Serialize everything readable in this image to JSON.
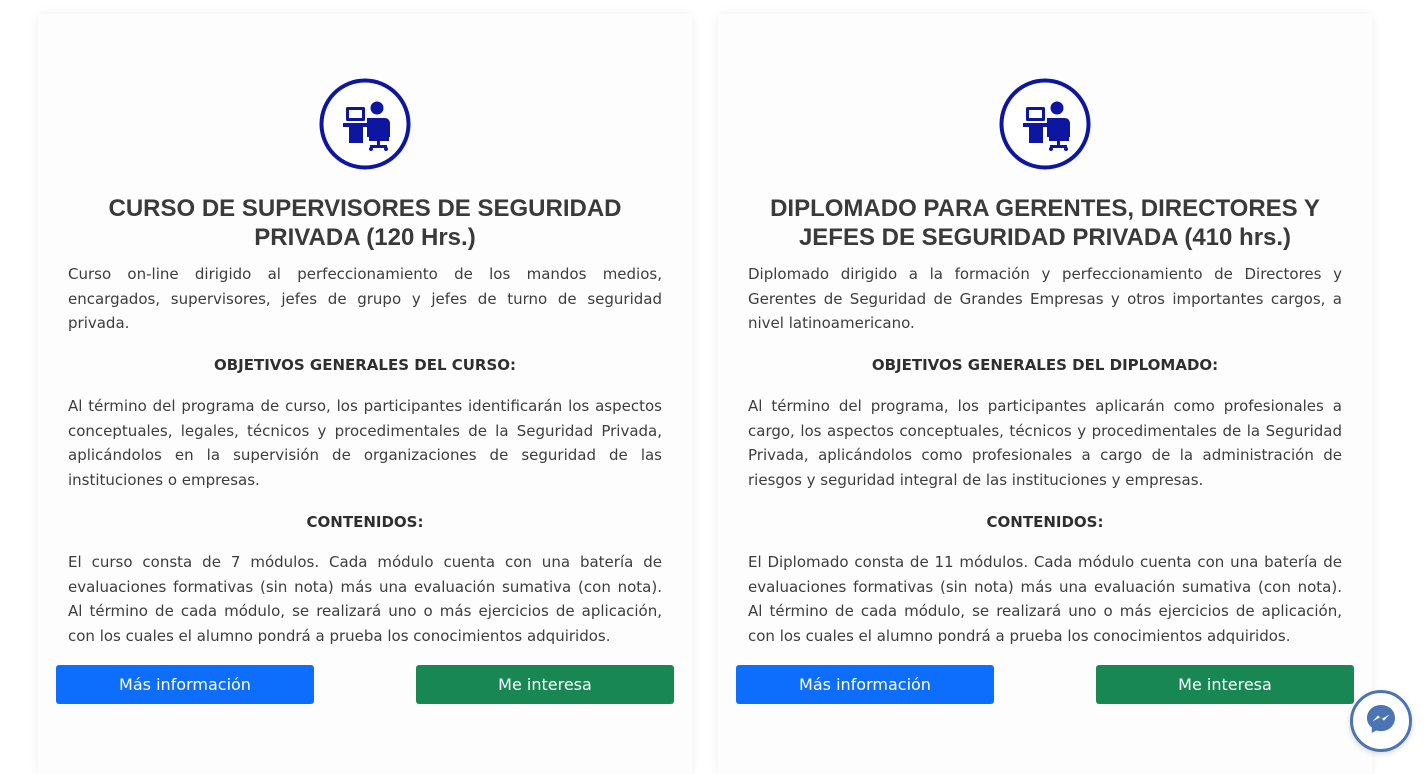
{
  "colors": {
    "icon_blue": "#0d16a0",
    "info_button": "#0d6efd",
    "interest_button": "#198754",
    "messenger_ring": "#4b74b3"
  },
  "cards": [
    {
      "icon": "security-operator-desk-icon",
      "title": "CURSO DE SUPERVISORES DE SEGURIDAD PRIVADA (120 Hrs.)",
      "description": "Curso on-line dirigido al perfeccionamiento de los mandos medios, encargados, supervisores, jefes de grupo y jefes de turno de seguridad privada.",
      "objectives_heading": "OBJETIVOS GENERALES DEL CURSO:",
      "objectives_text": "Al término del programa de curso, los participantes identificarán los aspectos conceptuales, legales, técnicos y procedimentales de la Seguridad Privada, aplicándolos en la supervisión de organizaciones de seguridad de las instituciones o empresas.",
      "contents_heading": "CONTENIDOS:",
      "contents_text": "El curso consta de 7 módulos. Cada módulo cuenta con una batería de evaluaciones formativas (sin nota) más una evaluación sumativa (con nota). Al término de cada módulo, se realizará uno o más ejercicios de aplicación, con los cuales el alumno pondrá a prueba los conocimientos adquiridos.",
      "info_button": "Más información",
      "interest_button": "Me interesa"
    },
    {
      "icon": "security-operator-desk-icon",
      "title": "DIPLOMADO PARA GERENTES, DIRECTORES Y JEFES DE SEGURIDAD PRIVADA (410 hrs.)",
      "description": "Diplomado dirigido a la formación y perfeccionamiento de Directores y Gerentes de Seguridad de Grandes Empresas y otros importantes cargos, a nivel latinoamericano.",
      "objectives_heading": "OBJETIVOS GENERALES DEL DIPLOMADO:",
      "objectives_text": "Al término del programa, los participantes aplicarán como profesionales a cargo, los aspectos conceptuales, técnicos y procedimentales de la Seguridad Privada, aplicándolos como profesionales a cargo de la administración de riesgos y seguridad integral de las instituciones y empresas.",
      "contents_heading": "CONTENIDOS:",
      "contents_text": "El Diplomado consta de 11 módulos. Cada módulo cuenta con una batería de evaluaciones formativas (sin nota) más una evaluación sumativa (con nota). Al término de cada módulo, se realizará uno o más ejercicios de aplicación, con los cuales el alumno pondrá a prueba los conocimientos adquiridos.",
      "info_button": "Más información",
      "interest_button": "Me interesa"
    }
  ],
  "messenger": {
    "icon": "messenger-icon"
  }
}
